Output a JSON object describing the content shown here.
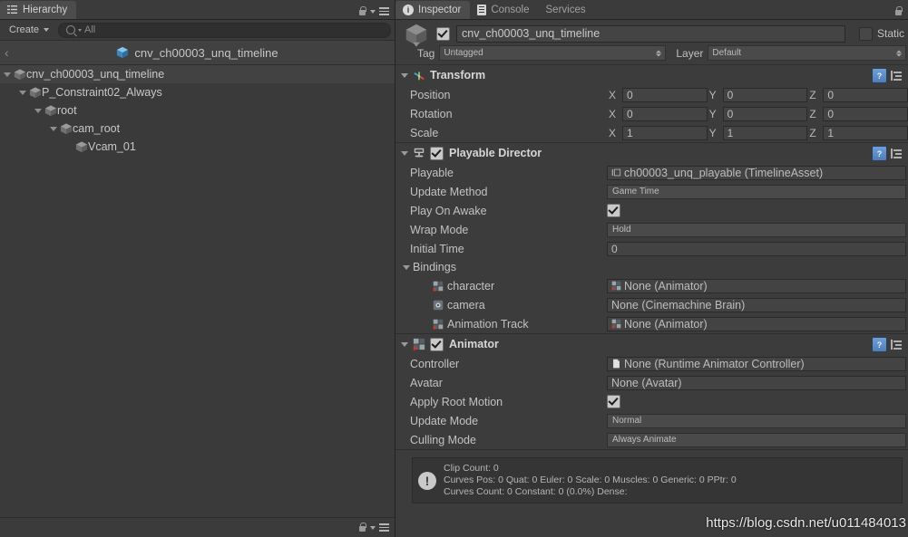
{
  "hierarchy": {
    "tab": {
      "label": "Hierarchy",
      "icon": "hierarchy-list-icon"
    },
    "toolbar": {
      "create_label": "Create",
      "search_placeholder": "All",
      "search_value": "All",
      "search_icon": "search-icon"
    },
    "breadcrumb": {
      "back_glyph": "‹",
      "prefab_name": "cnv_ch00003_unq_timeline",
      "prefab_icon": "prefab-cube-icon"
    },
    "tree": [
      {
        "label": "cnv_ch00003_unq_timeline",
        "depth": 0,
        "expanded": true,
        "selected": true,
        "icon": "gameobject-cube-icon"
      },
      {
        "label": "P_Constraint02_Always",
        "depth": 1,
        "expanded": true,
        "selected": false,
        "icon": "gameobject-cube-icon"
      },
      {
        "label": "root",
        "depth": 2,
        "expanded": true,
        "selected": false,
        "icon": "gameobject-cube-icon"
      },
      {
        "label": "cam_root",
        "depth": 3,
        "expanded": true,
        "selected": false,
        "icon": "gameobject-cube-icon"
      },
      {
        "label": "Vcam_01",
        "depth": 4,
        "expanded": false,
        "selected": false,
        "icon": "gameobject-cube-icon"
      }
    ],
    "footer": {
      "lock_icon": "lock-icon",
      "menu_icon": "hamburger-menu-icon"
    }
  },
  "inspector": {
    "tabs": [
      {
        "label": "Inspector",
        "icon": "info-circle-icon",
        "active": true
      },
      {
        "label": "Console",
        "icon": "console-icon",
        "active": false
      },
      {
        "label": "Services",
        "icon": "",
        "active": false
      }
    ],
    "lock_icon": "lock-icon",
    "object_header": {
      "enabled": true,
      "name_value": "cnv_ch00003_unq_timeline",
      "static_label": "Static",
      "static_checked": false,
      "tag_label": "Tag",
      "tag_value": "Untagged",
      "layer_label": "Layer",
      "layer_value": "Default",
      "icon": "gameobject-cube-icon"
    },
    "components": [
      {
        "name": "Transform",
        "icon": "transform-axis-icon",
        "has_checkbox": false,
        "expanded": true,
        "help_icon": "help-book-icon",
        "preset_icon": "preset-settings-icon",
        "vectors": [
          {
            "label": "Position",
            "x": "0",
            "y": "0",
            "z": "0"
          },
          {
            "label": "Rotation",
            "x": "0",
            "y": "0",
            "z": "0"
          },
          {
            "label": "Scale",
            "x": "1",
            "y": "1",
            "z": "1"
          }
        ]
      },
      {
        "name": "Playable Director",
        "icon": "playable-director-icon",
        "has_checkbox": true,
        "checked": true,
        "expanded": true,
        "help_icon": "help-book-icon",
        "preset_icon": "preset-settings-icon",
        "fields": [
          {
            "label": "Playable",
            "type": "object",
            "value": "ch00003_unq_playable (TimelineAsset)",
            "value_icon": "timeline-asset-icon"
          },
          {
            "label": "Update Method",
            "type": "enum",
            "value": "Game Time"
          },
          {
            "label": "Play On Awake",
            "type": "check",
            "checked": true
          },
          {
            "label": "Wrap Mode",
            "type": "enum",
            "value": "Hold"
          },
          {
            "label": "Initial Time",
            "type": "text",
            "value": "0"
          }
        ],
        "bindings": {
          "label": "Bindings",
          "expanded": true,
          "rows": [
            {
              "label": "character",
              "label_icon": "animator-icon",
              "value": "None (Animator)",
              "value_icon": "animator-icon"
            },
            {
              "label": "camera",
              "label_icon": "camera-brain-icon",
              "value": "None (Cinemachine Brain)",
              "value_icon": ""
            },
            {
              "label": "Animation Track",
              "label_icon": "animator-icon",
              "value": "None (Animator)",
              "value_icon": "animator-icon"
            }
          ]
        }
      },
      {
        "name": "Animator",
        "icon": "animator-icon",
        "has_checkbox": true,
        "checked": true,
        "expanded": true,
        "help_icon": "help-book-icon",
        "preset_icon": "preset-settings-icon",
        "fields": [
          {
            "label": "Controller",
            "type": "object",
            "value": "None (Runtime Animator Controller)",
            "value_icon": "document-icon"
          },
          {
            "label": "Avatar",
            "type": "object",
            "value": "None (Avatar)",
            "value_icon": ""
          },
          {
            "label": "Apply Root Motion",
            "type": "check",
            "checked": true
          },
          {
            "label": "Update Mode",
            "type": "enum",
            "value": "Normal"
          },
          {
            "label": "Culling Mode",
            "type": "enum",
            "value": "Always Animate"
          }
        ]
      }
    ],
    "helpbox": {
      "icon": "warning-icon",
      "line1": "Clip Count: 0",
      "line2": "Curves Pos: 0 Quat: 0 Euler: 0 Scale: 0 Muscles: 0 Generic: 0 PPtr: 0",
      "line3": "Curves Count: 0 Constant: 0 (0.0%) Dense:"
    }
  },
  "watermark": {
    "text": "https://blog.csdn.net/u011484013"
  },
  "colors": {
    "panel_bg": "#3c3c3c",
    "hierarchy_bg": "#3a3a3a",
    "tab_bg": "#3b3b3b",
    "tab_active": "#4c4c4c",
    "field_bg": "#434343",
    "enum_bg": "#4a4a4a",
    "border": "#2a2a2a",
    "text": "#c2c2c2",
    "accent_blue": "#5c8fce",
    "accent_red": "#c0392b"
  }
}
